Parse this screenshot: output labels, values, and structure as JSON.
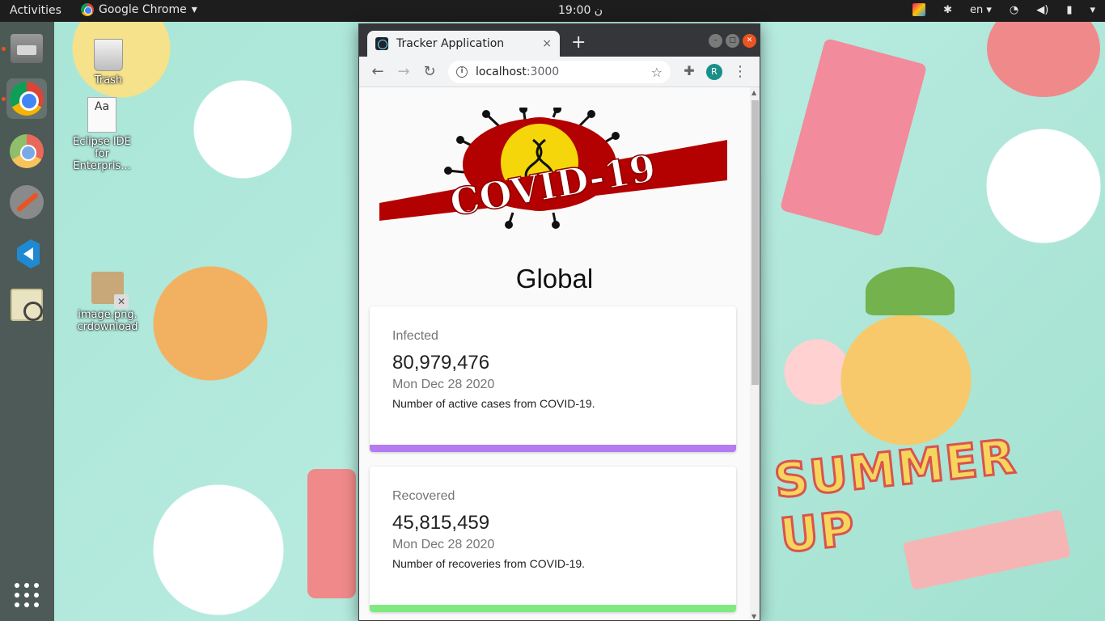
{
  "topbar": {
    "activities": "Activities",
    "app_name": "Google Chrome",
    "app_menu_arrow": "▾",
    "clock": "19:00 ن",
    "language": "en",
    "language_arrow": "▾"
  },
  "desktop": {
    "icons": [
      {
        "label": "Trash"
      },
      {
        "label": "Eclipse IDE for Enterpris..."
      },
      {
        "label": "image.png.crdownload"
      }
    ],
    "wallpaper_text": "SUMMER UP"
  },
  "browser": {
    "tab_title": "Tracker Application",
    "tab_close": "×",
    "new_tab": "+",
    "url_host": "localhost",
    "url_port": ":3000",
    "profile_initial": "R"
  },
  "page": {
    "logo_text": "COVID-19",
    "title": "Global",
    "cards": [
      {
        "label": "Infected",
        "value": "80,979,476",
        "date": "Mon Dec 28 2020",
        "description": "Number of active cases from COVID-19.",
        "bar_color": "#b57bf2"
      },
      {
        "label": "Recovered",
        "value": "45,815,459",
        "date": "Mon Dec 28 2020",
        "description": "Number of recoveries from COVID-19.",
        "bar_color": "#7fea7f"
      }
    ]
  },
  "colors": {
    "ubuntu_orange": "#e95420",
    "chrome_frame": "#35363a",
    "logo_red": "#b30000",
    "logo_yellow": "#f5d60a"
  }
}
